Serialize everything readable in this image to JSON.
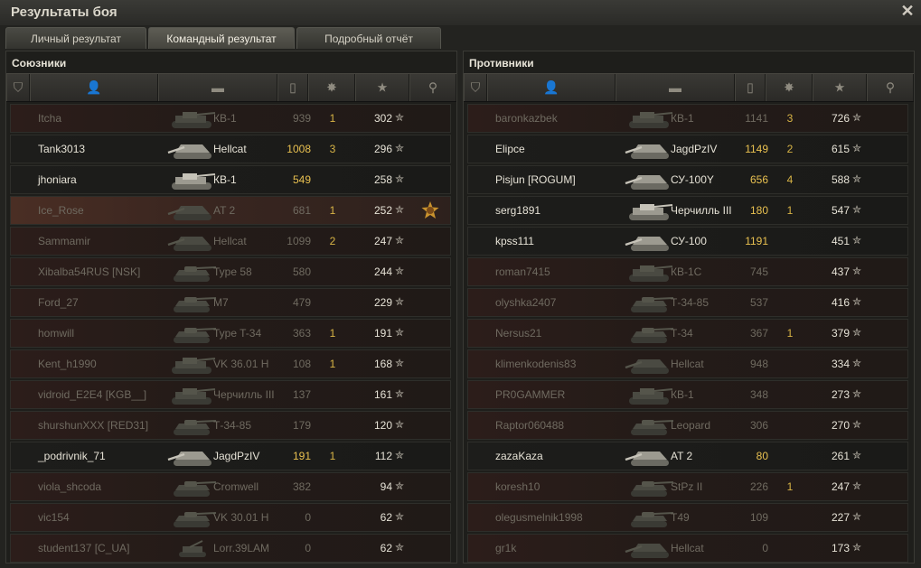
{
  "window": {
    "title": "Результаты боя"
  },
  "tabs": [
    {
      "label": "Личный результат",
      "active": false
    },
    {
      "label": "Командный результат",
      "active": true
    },
    {
      "label": "Подробный отчёт",
      "active": false
    }
  ],
  "colors": {
    "accent_damage": "#e8c050",
    "dead_text": "#6f6a60",
    "alive_text": "#e6e2d6"
  },
  "allies": {
    "title": "Союзники",
    "header_icons": [
      "platoon-icon",
      "player-icon",
      "tank-icon",
      "damage-icon",
      "kills-icon",
      "xp-sort-icon",
      "medal-icon"
    ],
    "rows": [
      {
        "name": "Itcha",
        "tank": "КВ-1",
        "damage": "939",
        "kills": "1",
        "xp": "302",
        "alive": false,
        "medal": false,
        "tank_shape": "heavy"
      },
      {
        "name": "Tank3013",
        "tank": "Hellcat",
        "damage": "1008",
        "kills": "3",
        "xp": "296",
        "alive": true,
        "medal": false,
        "tank_shape": "td"
      },
      {
        "name": "jhoniara",
        "tank": "КВ-1",
        "damage": "549",
        "kills": "",
        "xp": "258",
        "alive": true,
        "medal": false,
        "tank_shape": "heavy"
      },
      {
        "name": "Ice_Rose",
        "tank": "AT 2",
        "damage": "681",
        "kills": "1",
        "xp": "252",
        "alive": false,
        "medal": true,
        "highlight": true,
        "tank_shape": "td"
      },
      {
        "name": "Sammamir",
        "tank": "Hellcat",
        "damage": "1099",
        "kills": "2",
        "xp": "247",
        "alive": false,
        "medal": false,
        "tank_shape": "td"
      },
      {
        "name": "Xibalba54RUS [NSK]",
        "tank": "Type 58",
        "damage": "580",
        "kills": "",
        "xp": "244",
        "alive": false,
        "medal": false,
        "tank_shape": "medium"
      },
      {
        "name": "Ford_27",
        "tank": "M7",
        "damage": "479",
        "kills": "",
        "xp": "229",
        "alive": false,
        "medal": false,
        "tank_shape": "medium"
      },
      {
        "name": "homwill",
        "tank": "Type T-34",
        "damage": "363",
        "kills": "1",
        "xp": "191",
        "alive": false,
        "medal": false,
        "tank_shape": "medium"
      },
      {
        "name": "Kent_h1990",
        "tank": "VK 36.01 H",
        "damage": "108",
        "kills": "1",
        "xp": "168",
        "alive": false,
        "medal": false,
        "tank_shape": "heavy"
      },
      {
        "name": "vidroid_E2E4 [KGB__]",
        "tank": "Черчилль III",
        "damage": "137",
        "kills": "",
        "xp": "161",
        "alive": false,
        "medal": false,
        "tank_shape": "heavy"
      },
      {
        "name": "shurshunXXX [RED31]",
        "tank": "Т-34-85",
        "damage": "179",
        "kills": "",
        "xp": "120",
        "alive": false,
        "medal": false,
        "tank_shape": "medium"
      },
      {
        "name": "_podrivnik_71",
        "tank": "JagdPzIV",
        "damage": "191",
        "kills": "1",
        "xp": "112",
        "alive": true,
        "medal": false,
        "tank_shape": "td"
      },
      {
        "name": "viola_shcoda",
        "tank": "Cromwell",
        "damage": "382",
        "kills": "",
        "xp": "94",
        "alive": false,
        "medal": false,
        "tank_shape": "medium"
      },
      {
        "name": "vic154",
        "tank": "VK 30.01 H",
        "damage": "0",
        "kills": "",
        "xp": "62",
        "alive": false,
        "medal": false,
        "tank_shape": "medium"
      },
      {
        "name": "student137 [C_UA]",
        "tank": "Lorr.39LAM",
        "damage": "0",
        "kills": "",
        "xp": "62",
        "alive": false,
        "medal": false,
        "tank_shape": "spg"
      }
    ]
  },
  "enemies": {
    "title": "Противники",
    "header_icons": [
      "platoon-icon",
      "player-icon",
      "tank-icon",
      "damage-icon",
      "kills-icon",
      "xp-sort-icon",
      "medal-icon"
    ],
    "rows": [
      {
        "name": "baronkazbek",
        "tank": "КВ-1",
        "damage": "1141",
        "kills": "3",
        "xp": "726",
        "alive": false,
        "medal": false,
        "tank_shape": "heavy"
      },
      {
        "name": "Elipce",
        "tank": "JagdPzIV",
        "damage": "1149",
        "kills": "2",
        "xp": "615",
        "alive": true,
        "medal": false,
        "tank_shape": "td"
      },
      {
        "name": "Pisjun [ROGUM]",
        "tank": "СУ-100Y",
        "damage": "656",
        "kills": "4",
        "xp": "588",
        "alive": true,
        "medal": false,
        "tank_shape": "td"
      },
      {
        "name": "serg1891",
        "tank": "Черчилль III",
        "damage": "180",
        "kills": "1",
        "xp": "547",
        "alive": true,
        "medal": false,
        "tank_shape": "heavy"
      },
      {
        "name": "kpss111",
        "tank": "СУ-100",
        "damage": "1191",
        "kills": "",
        "xp": "451",
        "alive": true,
        "medal": false,
        "tank_shape": "td"
      },
      {
        "name": "roman7415",
        "tank": "КВ-1С",
        "damage": "745",
        "kills": "",
        "xp": "437",
        "alive": false,
        "medal": false,
        "tank_shape": "heavy"
      },
      {
        "name": "olyshka2407",
        "tank": "Т-34-85",
        "damage": "537",
        "kills": "",
        "xp": "416",
        "alive": false,
        "medal": false,
        "tank_shape": "medium"
      },
      {
        "name": "Nersus21",
        "tank": "Т-34",
        "damage": "367",
        "kills": "1",
        "xp": "379",
        "alive": false,
        "medal": false,
        "tank_shape": "medium"
      },
      {
        "name": "klimenkodenis83",
        "tank": "Hellcat",
        "damage": "948",
        "kills": "",
        "xp": "334",
        "alive": false,
        "medal": false,
        "tank_shape": "td"
      },
      {
        "name": "PR0GAMMER",
        "tank": "КВ-1",
        "damage": "348",
        "kills": "",
        "xp": "273",
        "alive": false,
        "medal": false,
        "tank_shape": "heavy"
      },
      {
        "name": "Raptor060488",
        "tank": "Leopard",
        "damage": "306",
        "kills": "",
        "xp": "270",
        "alive": false,
        "medal": false,
        "tank_shape": "medium"
      },
      {
        "name": "zazaKaza",
        "tank": "AT 2",
        "damage": "80",
        "kills": "",
        "xp": "261",
        "alive": true,
        "medal": false,
        "tank_shape": "td"
      },
      {
        "name": "koresh10",
        "tank": "StPz II",
        "damage": "226",
        "kills": "1",
        "xp": "247",
        "alive": false,
        "medal": false,
        "tank_shape": "medium"
      },
      {
        "name": "olegusmelnik1998",
        "tank": "T49",
        "damage": "109",
        "kills": "",
        "xp": "227",
        "alive": false,
        "medal": false,
        "tank_shape": "medium"
      },
      {
        "name": "gr1k",
        "tank": "Hellcat",
        "damage": "0",
        "kills": "",
        "xp": "173",
        "alive": false,
        "medal": false,
        "tank_shape": "td"
      }
    ]
  }
}
